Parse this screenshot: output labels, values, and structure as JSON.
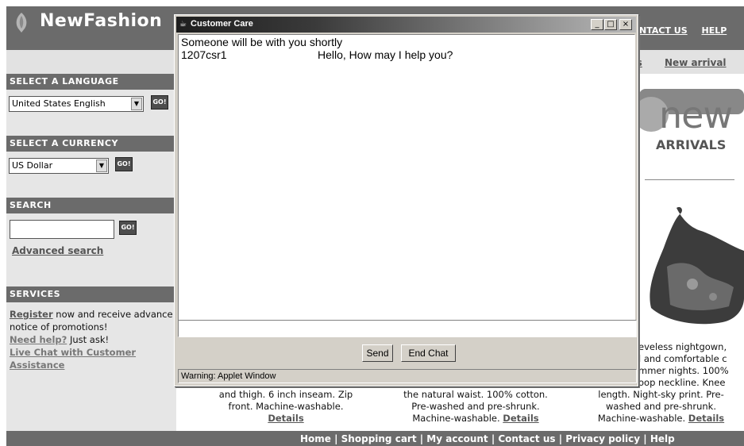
{
  "site": {
    "brand": "NewFashion",
    "top_links": [
      "NTACT US",
      "HELP"
    ],
    "subnav_links": [
      "'s",
      "New arrival"
    ]
  },
  "sidebar": {
    "language": {
      "heading": "SELECT A LANGUAGE",
      "value": "United States English",
      "go": "GO!"
    },
    "currency": {
      "heading": "SELECT A CURRENCY",
      "value": "US Dollar",
      "go": "GO!"
    },
    "search": {
      "heading": "SEARCH",
      "go": "GO!",
      "advanced": "Advanced search"
    },
    "services": {
      "heading": "SERVICES",
      "register_link": "Register",
      "register_text": " now and receive advance notice of promotions!",
      "help_link": "Need help?",
      "help_text": " Just ask!",
      "live_chat_link": "Live Chat with Customer Assistance"
    }
  },
  "promo": {
    "new": "new",
    "arrivals": "ARRIVALS"
  },
  "products": [
    {
      "lines": [
        "and thigh. 6 inch inseam. Zip",
        "front. Machine-washable."
      ],
      "details": "Details"
    },
    {
      "lines": [
        "the natural waist. 100% cotton.",
        "Pre-washed and pre-shrunk.",
        "Machine-washable. "
      ],
      "details": "Details"
    },
    {
      "lines": [
        "length. Night-sky print. Pre-",
        "washed and pre-shrunk.",
        "Machine-washable. "
      ],
      "details": "Details"
    }
  ],
  "right_desc": [
    "eveless nightgown,",
    "l and comfortable c",
    "mmer nights. 100%",
    "oop neckline. Knee"
  ],
  "footer": "Home | Shopping cart | My account | Contact us | Privacy policy | Help",
  "chat_window": {
    "title": "Customer Care",
    "buttons": {
      "minimize": "_",
      "maximize": "□",
      "close": "×"
    },
    "lines": [
      {
        "sender": "Someone will be with you shortly",
        "text": ""
      },
      {
        "sender": "1207csr1",
        "text": "Hello, How may I help you?"
      }
    ],
    "send_label": "Send",
    "end_chat_label": "End Chat",
    "status": "Warning: Applet Window"
  },
  "colors": {
    "header": "#6b6b6b",
    "sidebar": "#e6e6e6",
    "window_chrome": "#d4d0c8"
  }
}
